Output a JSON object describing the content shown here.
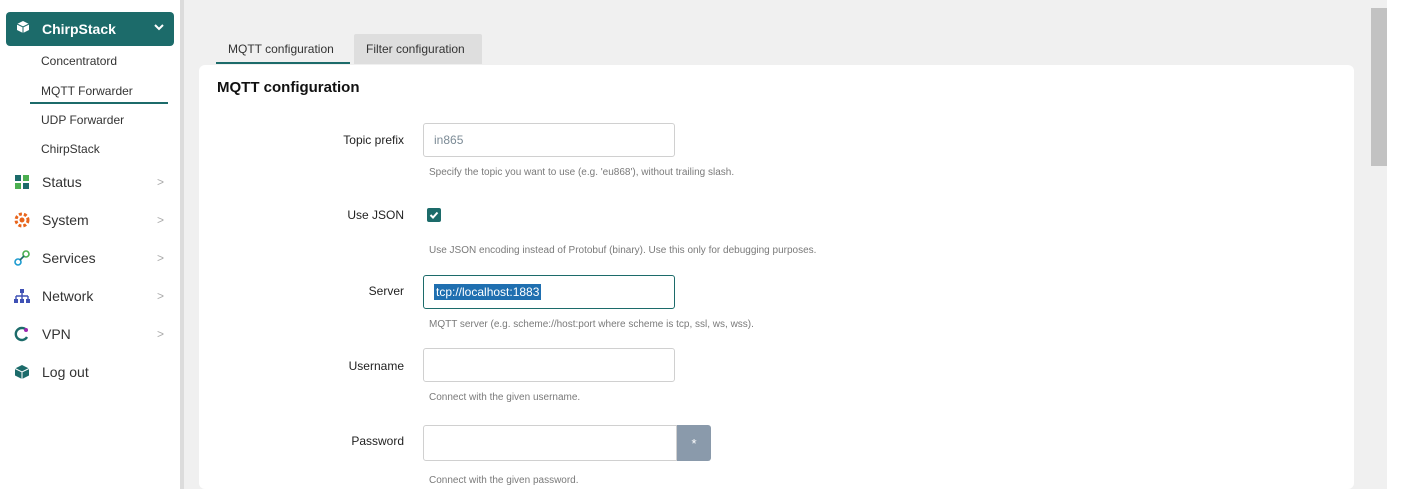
{
  "sidebar": {
    "active_group": {
      "label": "ChirpStack",
      "icon": "box-icon",
      "chevron": "chevron-down-icon"
    },
    "sub_items": [
      {
        "label": "Concentratord"
      },
      {
        "label": "MQTT Forwarder",
        "active": true
      },
      {
        "label": "UDP Forwarder"
      },
      {
        "label": "ChirpStack"
      }
    ],
    "nav_items": [
      {
        "label": "Status",
        "icon": "status-grid-icon",
        "arrow": ">"
      },
      {
        "label": "System",
        "icon": "system-gear-icon",
        "arrow": ">"
      },
      {
        "label": "Services",
        "icon": "services-link-icon",
        "arrow": ">"
      },
      {
        "label": "Network",
        "icon": "network-tree-icon",
        "arrow": ">"
      },
      {
        "label": "VPN",
        "icon": "vpn-icon",
        "arrow": ">"
      },
      {
        "label": "Log out",
        "icon": "box-icon"
      }
    ],
    "accent_color": "#1c6b6a"
  },
  "tabs": [
    {
      "label": "MQTT configuration",
      "active": true
    },
    {
      "label": "Filter configuration",
      "active": false
    }
  ],
  "panel": {
    "title": "MQTT configuration",
    "fields": {
      "topic_prefix": {
        "label": "Topic prefix",
        "value": "in865",
        "help": "Specify the topic you want to use (e.g. 'eu868'), without trailing slash."
      },
      "use_json": {
        "label": "Use JSON",
        "checked": true,
        "help": "Use JSON encoding instead of Protobuf (binary). Use this only for debugging purposes."
      },
      "server": {
        "label": "Server",
        "value": "tcp://localhost:1883",
        "help": "MQTT server (e.g. scheme://host:port where scheme is tcp, ssl, ws, wss)."
      },
      "username": {
        "label": "Username",
        "value": "",
        "help": "Connect with the given username."
      },
      "password": {
        "label": "Password",
        "value": "",
        "reveal_symbol": "*",
        "help": "Connect with the given password."
      }
    }
  }
}
